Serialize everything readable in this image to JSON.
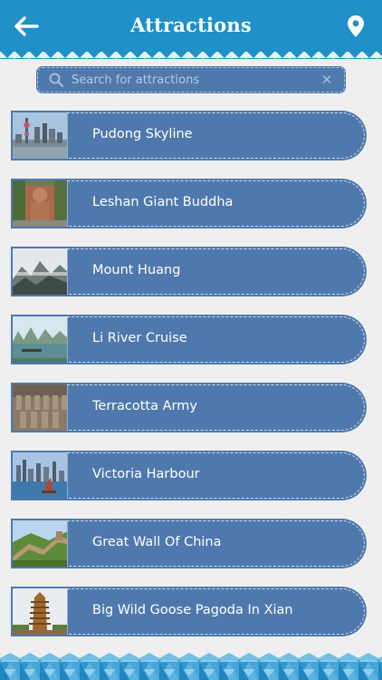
{
  "header": {
    "title": "Attractions",
    "back_icon": "arrow-left-icon",
    "location_icon": "map-pin-icon",
    "bg_color": "#1f90c8"
  },
  "search": {
    "placeholder": "Search for attractions",
    "value": "",
    "search_icon": "magnifier-icon",
    "clear_icon": "close-icon"
  },
  "attractions": [
    {
      "label": "Pudong Skyline",
      "thumb": "city-skyline-photo"
    },
    {
      "label": "Leshan Giant Buddha",
      "thumb": "buddha-statue-photo"
    },
    {
      "label": "Mount Huang",
      "thumb": "mountain-photo"
    },
    {
      "label": "Li River Cruise",
      "thumb": "river-karst-photo"
    },
    {
      "label": "Terracotta Army",
      "thumb": "terracotta-photo"
    },
    {
      "label": "Victoria Harbour",
      "thumb": "harbour-photo"
    },
    {
      "label": "Great Wall Of China",
      "thumb": "great-wall-photo"
    },
    {
      "label": "Big Wild Goose Pagoda In Xian",
      "thumb": "pagoda-photo"
    }
  ],
  "colors": {
    "accent": "#1f90c8",
    "item_bg": "#4f79ad",
    "page_bg": "#efefef"
  }
}
